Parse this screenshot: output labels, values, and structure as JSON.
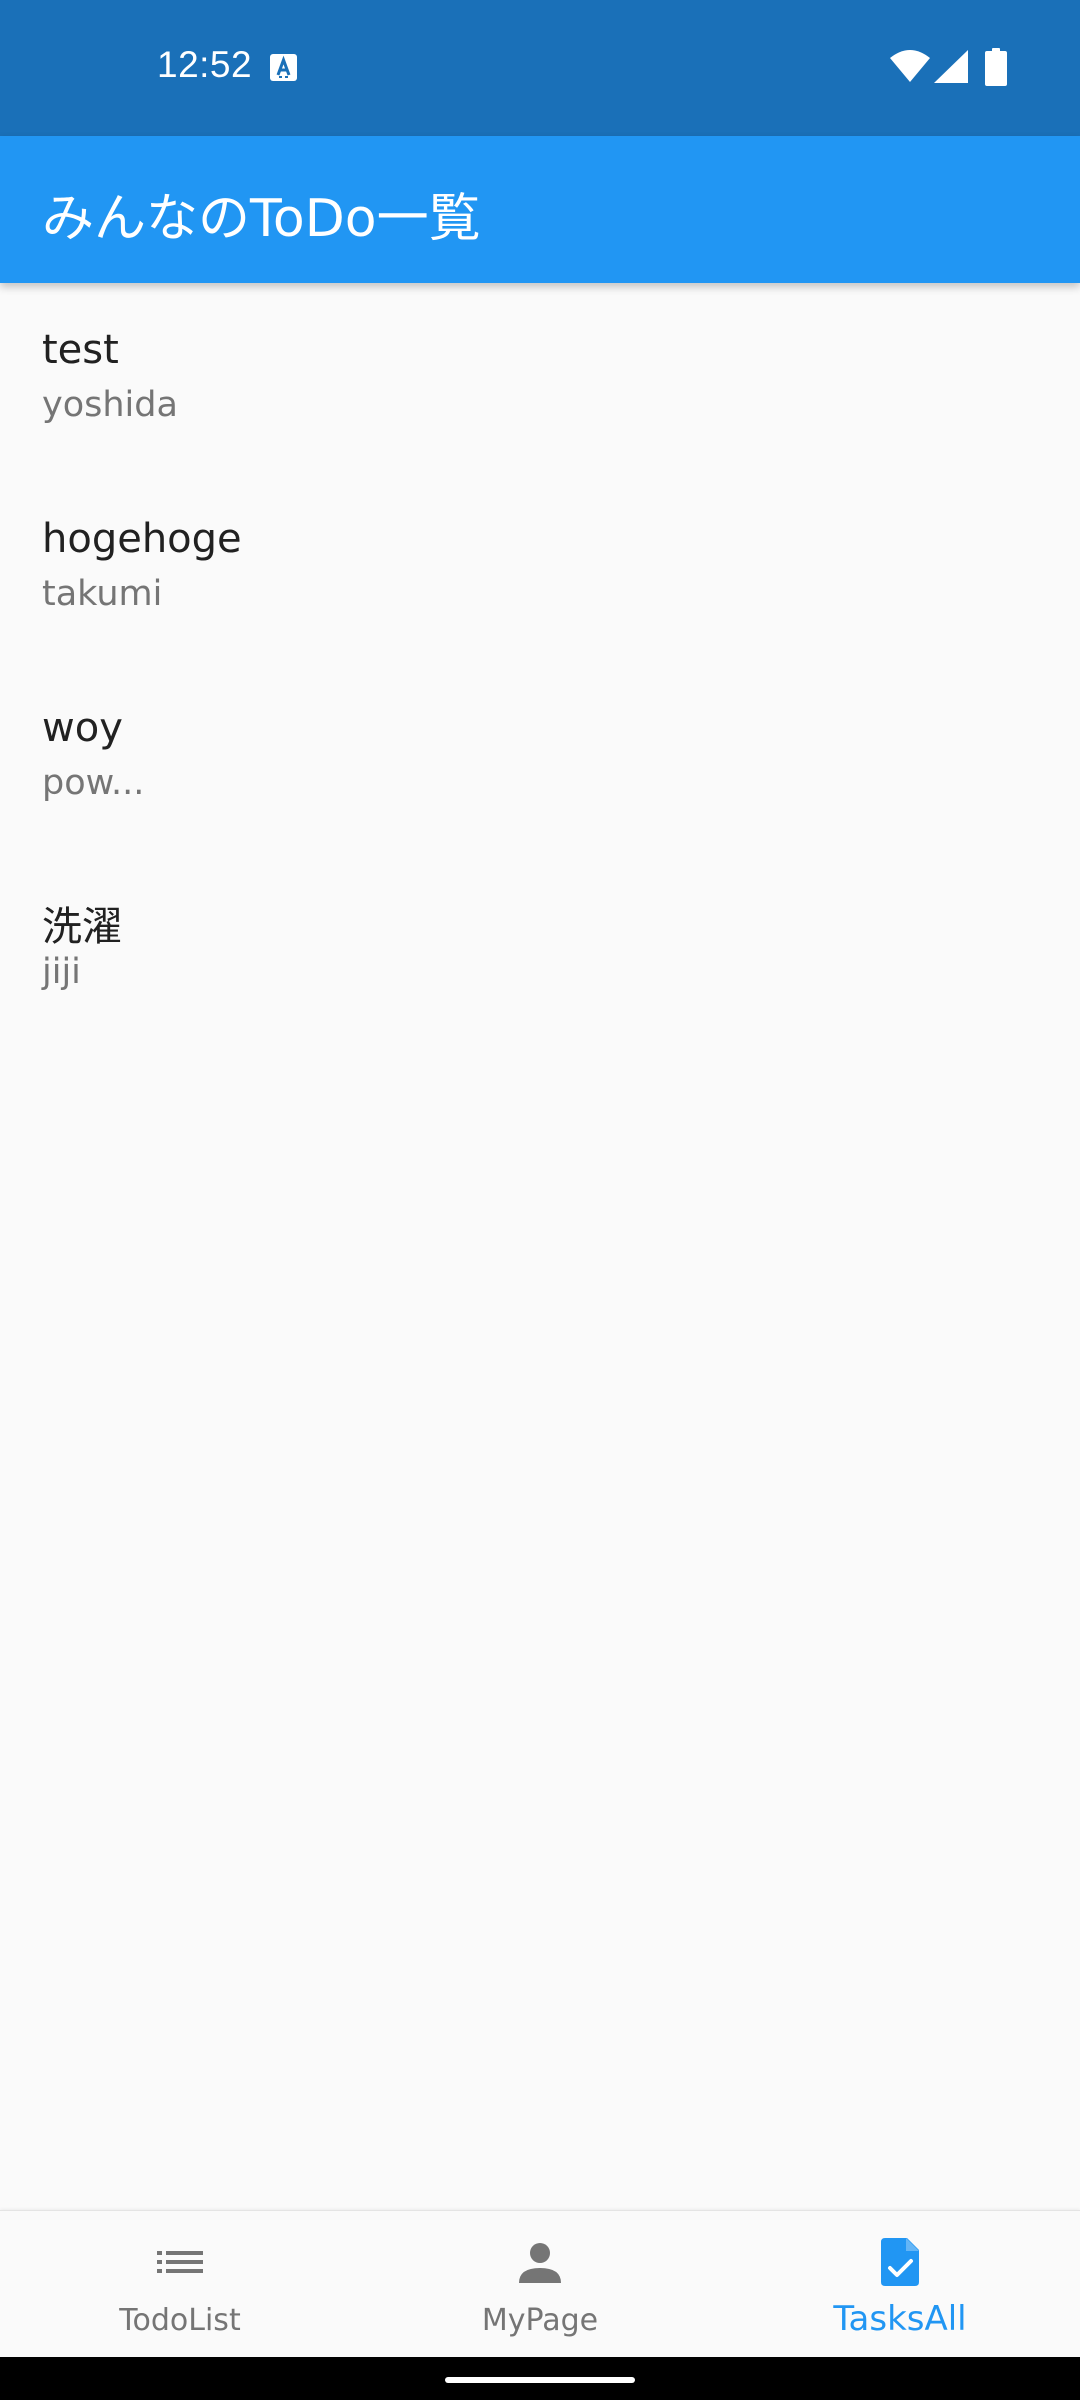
{
  "status_bar": {
    "time": "12:52",
    "icons": [
      "a-notification-icon",
      "wifi-icon",
      "cell-signal-icon",
      "battery-icon"
    ]
  },
  "app_bar": {
    "title": "みんなのToDo一覧"
  },
  "tasks": [
    {
      "title": "test",
      "user": "yoshida"
    },
    {
      "title": "hogehoge",
      "user": "takumi"
    },
    {
      "title": "woy",
      "user": "pow..."
    },
    {
      "title": "洗濯",
      "user": "jiji"
    }
  ],
  "bottom_nav": {
    "items": [
      {
        "label": "TodoList",
        "icon": "list-icon",
        "active": false
      },
      {
        "label": "MyPage",
        "icon": "person-icon",
        "active": false
      },
      {
        "label": "TasksAll",
        "icon": "task-check-icon",
        "active": true
      }
    ]
  },
  "colors": {
    "status_bar": "#1a70b8",
    "app_bar": "#2196f3",
    "background": "#fafafa",
    "active_nav": "#2196f3",
    "inactive_nav": "#757575",
    "title_text": "#212121",
    "subtitle_text": "#757575"
  }
}
